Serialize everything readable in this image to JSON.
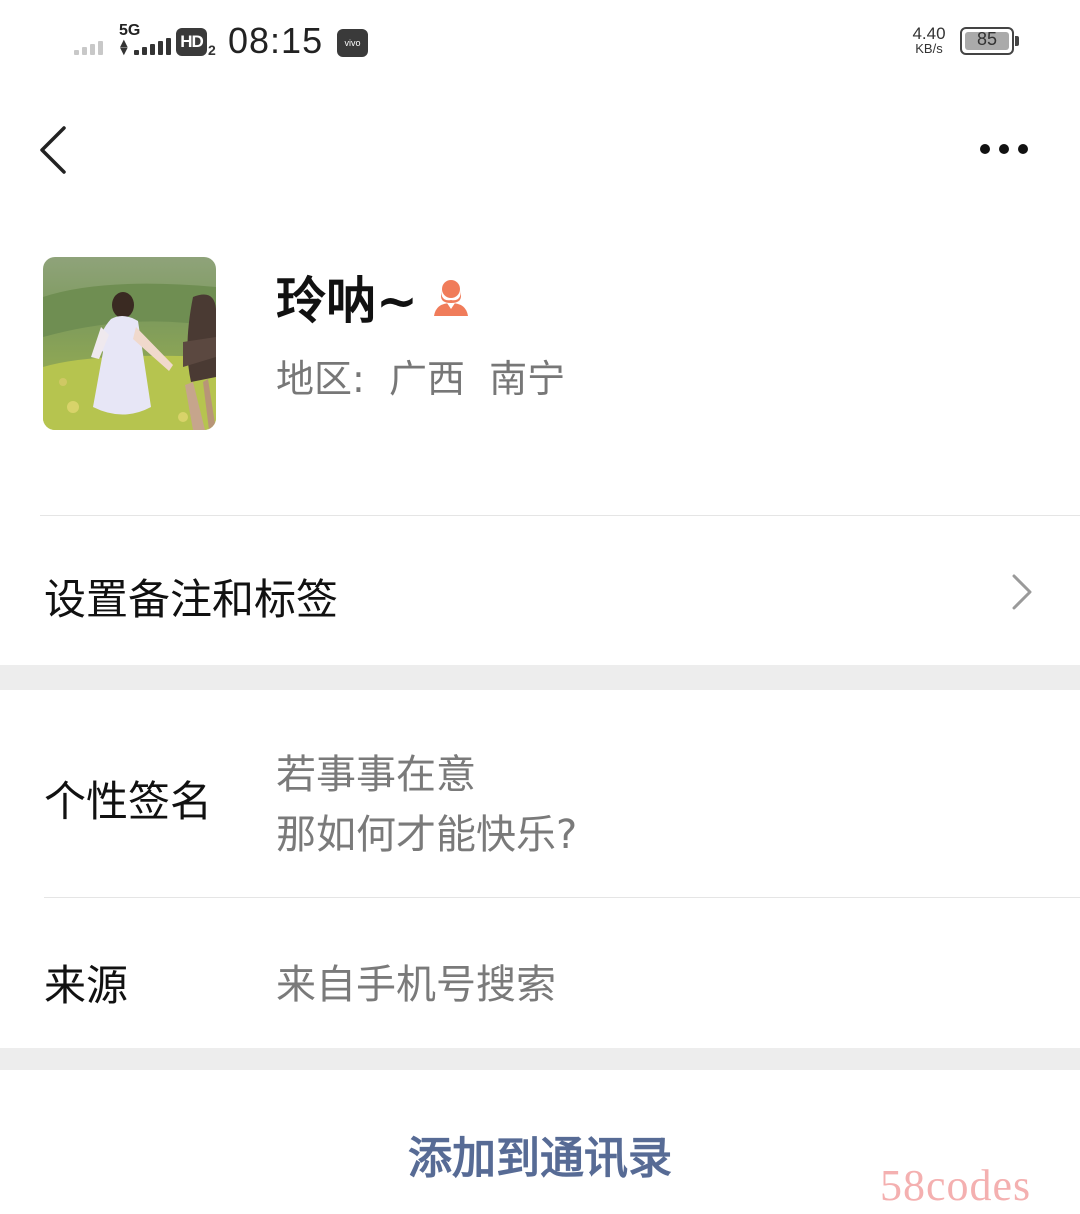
{
  "status_bar": {
    "network": "5G",
    "hd_label": "HD",
    "hd_sub": "2",
    "time": "08:15",
    "carrier_badge": "vivo",
    "speed_value": "4.40",
    "speed_unit": "KB/s",
    "battery_level": "85"
  },
  "nav": {
    "back_icon": "chevron-left-icon",
    "more_icon": "more-dots-icon"
  },
  "profile": {
    "name": "玲呐~",
    "gender_icon": "female-user-icon",
    "gender_color": "#f07c5a",
    "region_label": "地区:",
    "region_province": "广西",
    "region_city": "南宁"
  },
  "rows": {
    "remark_label": "设置备注和标签",
    "signature_label": "个性签名",
    "signature_line1": "若事事在意",
    "signature_line2": "那如何才能快乐?",
    "source_label": "来源",
    "source_value": "来自手机号搜索"
  },
  "actions": {
    "add_contact": "添加到通讯录"
  },
  "watermark": "58codes",
  "colors": {
    "link": "#576b95",
    "secondary_text": "#7a7a7a",
    "separator": "#ededed"
  }
}
